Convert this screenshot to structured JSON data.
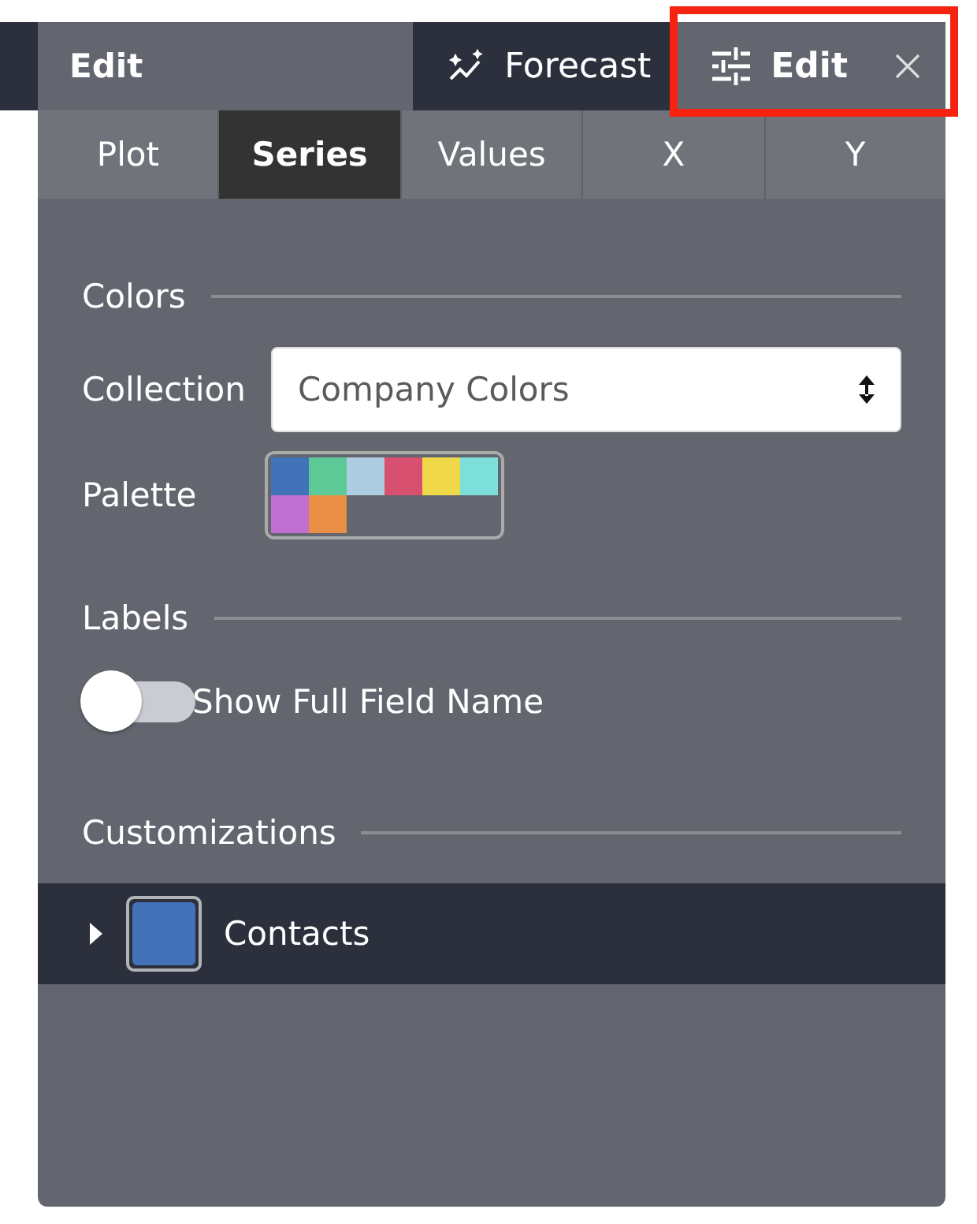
{
  "header": {
    "title": "Edit",
    "tabs": [
      {
        "kind": "forecast",
        "label": "Forecast",
        "selected": false,
        "highlighted": false
      },
      {
        "kind": "editor",
        "label": "Edit",
        "selected": true,
        "highlighted": true
      }
    ]
  },
  "subtabs": [
    {
      "label": "Plot",
      "selected": false
    },
    {
      "label": "Series",
      "selected": true
    },
    {
      "label": "Values",
      "selected": false
    },
    {
      "label": "X",
      "selected": false
    },
    {
      "label": "Y",
      "selected": false
    }
  ],
  "sections": [
    {
      "heading": "Colors",
      "items": [
        {
          "kind": "select",
          "label": "Collection",
          "value": "Company Colors"
        },
        {
          "kind": "palette",
          "label": "Palette",
          "swatches": [
            {
              "color": "#4272b8"
            },
            {
              "color": "#5cc996"
            },
            {
              "color": "#aecde3"
            },
            {
              "color": "#d8506f"
            },
            {
              "color": "#efd84a"
            },
            {
              "color": "#7ddfd9"
            },
            {
              "color": "#bf6fcf"
            },
            {
              "color": "#e88e45"
            }
          ]
        }
      ]
    },
    {
      "heading": "Labels",
      "items": [
        {
          "kind": "toggle",
          "label": "Show Full Field Name",
          "on": false
        }
      ]
    },
    {
      "heading": "Customizations",
      "items": [
        {
          "kind": "series",
          "label": "Contacts",
          "color": "#4272b8",
          "expanded": false
        }
      ]
    }
  ]
}
